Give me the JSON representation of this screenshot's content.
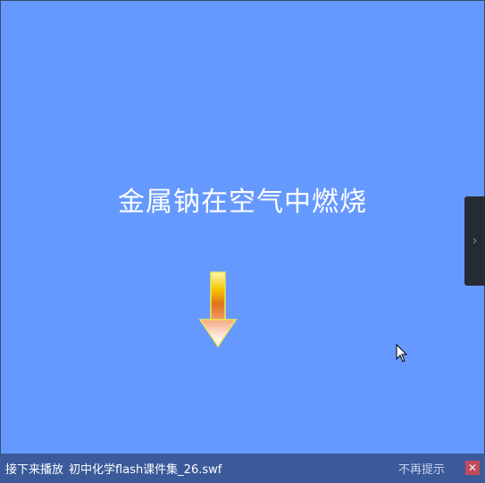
{
  "slide": {
    "title": "金属钠在空气中燃烧",
    "background_color": "#6699ff",
    "arrow_icon": "down-arrow-icon"
  },
  "side_panel": {
    "toggle_icon": "chevron-right-icon",
    "toggle_glyph": "›"
  },
  "next_bar": {
    "label": "接下来播放",
    "file_name": "初中化学flash课件集_26.swf",
    "dismiss_label": "不再提示",
    "close_glyph": "✕",
    "bar_color": "#3a5a9a",
    "close_color": "#c24a5a"
  }
}
